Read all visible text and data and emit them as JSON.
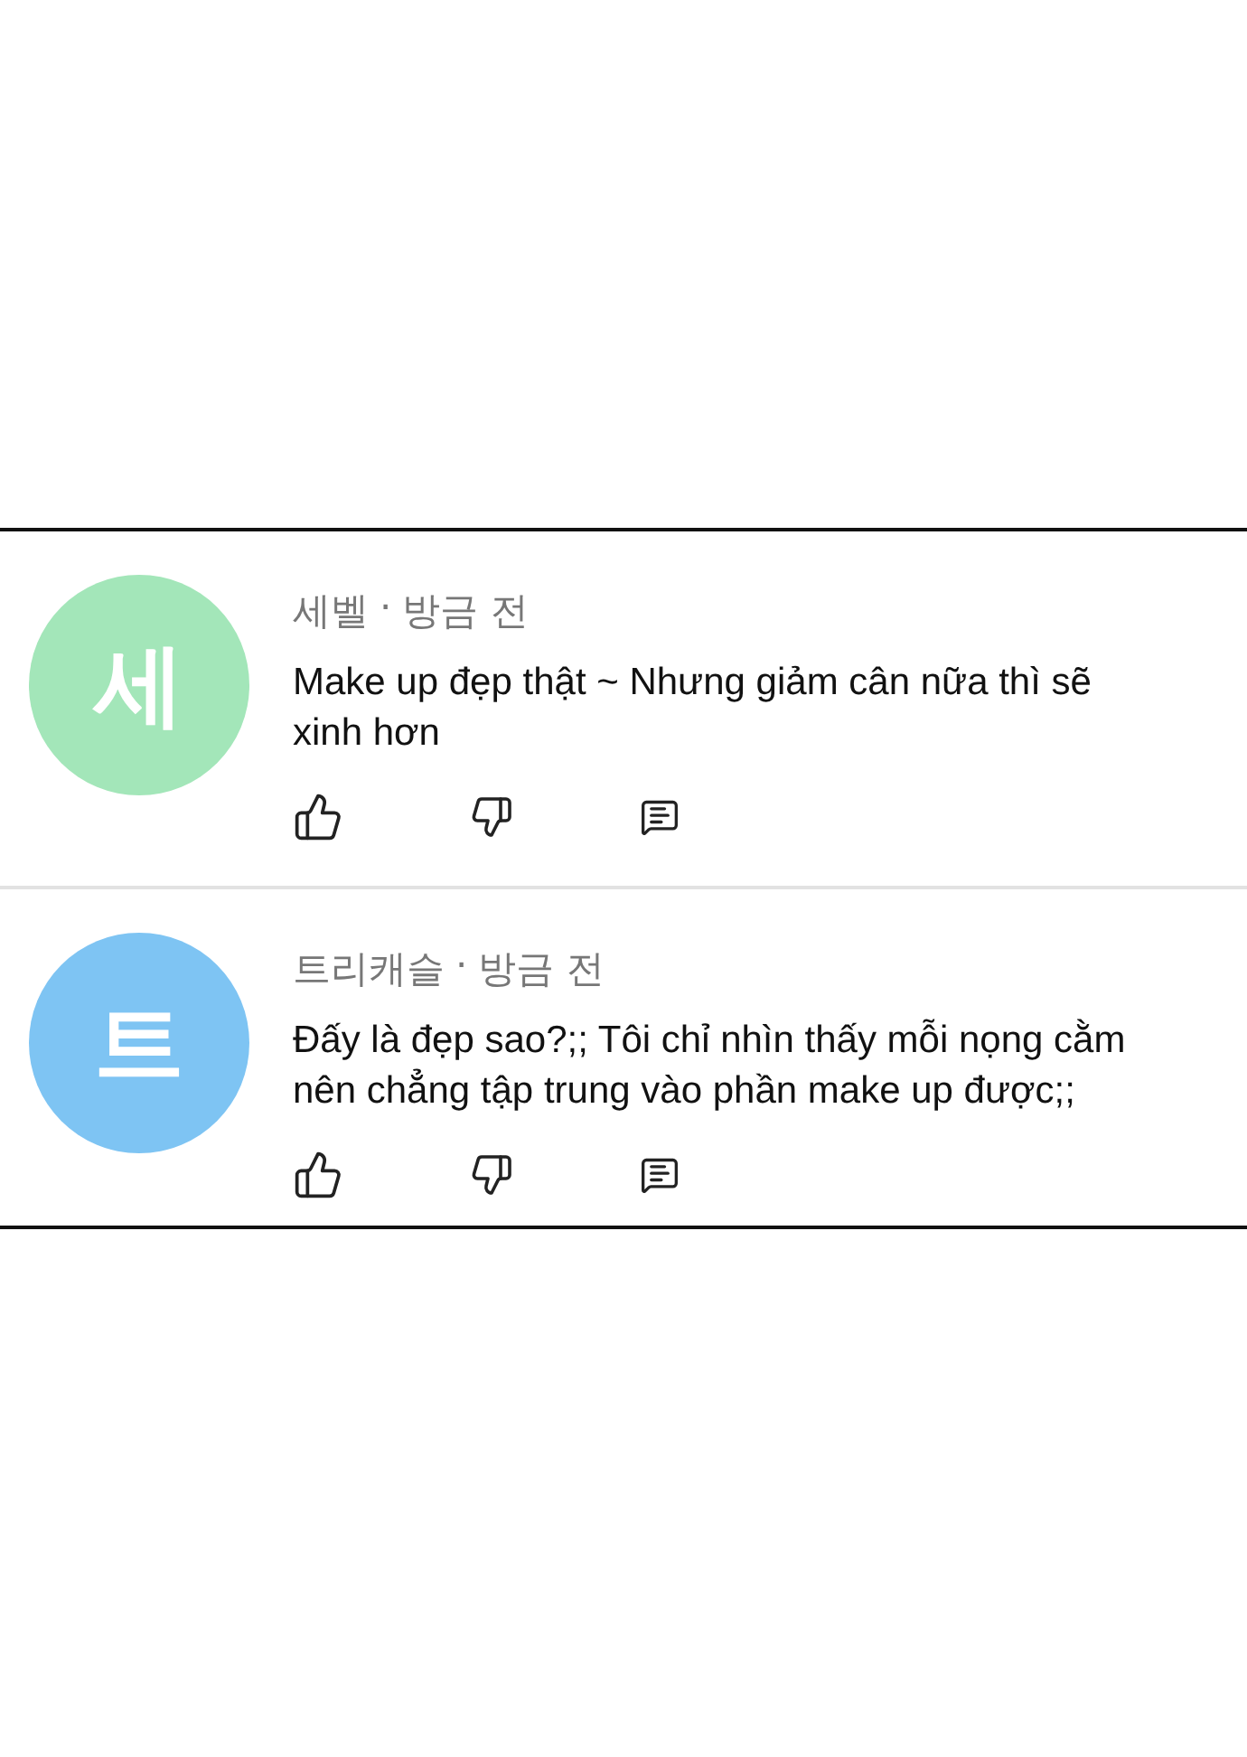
{
  "comments": [
    {
      "avatar_letter": "세",
      "color": "#a3e6b9",
      "author": "세벨",
      "separator": "·",
      "time": "방금 전",
      "text": "Make up đẹp thật ~ Nhưng giảm cân nữa thì sẽ xinh hơn"
    },
    {
      "avatar_letter": "트",
      "color": "#7ec4f3",
      "author": "트리캐슬",
      "separator": "·",
      "time": "방금 전",
      "text": "Đấy là đẹp sao?;; Tôi chỉ nhìn thấy mỗi nọng cằm nên chẳng tập trung vào phần make up được;;"
    }
  ]
}
